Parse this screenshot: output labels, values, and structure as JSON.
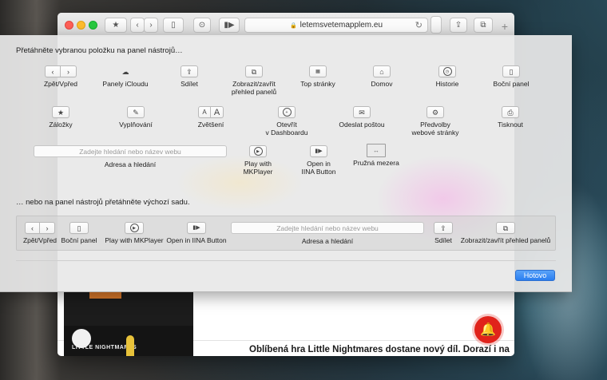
{
  "browser": {
    "url": "letemsvetemapplem.eu",
    "lock_icon": "🔒"
  },
  "page": {
    "headline": "Oblíbená hra Little Nightmares dostane nový díl. Dorazí i na",
    "thumb_label": "LITTLE NIGHTMARES"
  },
  "sheet": {
    "title": "Přetáhněte vybranou položku na panel nástrojů…",
    "items_row1": [
      {
        "label": "Zpět/Vpřed",
        "icon": "back-forward-icon"
      },
      {
        "label": "Panely iCloudu",
        "icon": "cloud-icon"
      },
      {
        "label": "Sdílet",
        "icon": "share-icon"
      },
      {
        "label": "Zobrazit/zavřít\npřehled panelů",
        "icon": "tab-overview-icon"
      },
      {
        "label": "Top stránky",
        "icon": "grid-icon"
      },
      {
        "label": "Domov",
        "icon": "home-icon"
      },
      {
        "label": "Historie",
        "icon": "clock-icon"
      },
      {
        "label": "Boční panel",
        "icon": "sidebar-icon"
      }
    ],
    "items_row2": [
      {
        "label": "Záložky",
        "icon": "bookmarks-icon"
      },
      {
        "label": "Vyplňování",
        "icon": "autofill-icon"
      },
      {
        "label": "Zvětšení",
        "icon": "zoom-icon"
      },
      {
        "label": "Otevřít\nv Dashboardu",
        "icon": "dashboard-icon"
      },
      {
        "label": "Odeslat poštou",
        "icon": "mail-icon"
      },
      {
        "label": "Předvolby\nwebové stránky",
        "icon": "gear-icon"
      },
      {
        "label": "Tisknout",
        "icon": "print-icon"
      }
    ],
    "items_row3": [
      {
        "label": "Adresa a hledání",
        "placeholder": "Zadejte hledání nebo název webu"
      },
      {
        "label": "Play with\nMKPlayer",
        "icon": "play-icon"
      },
      {
        "label": "Open in\nIINA Button",
        "icon": "iina-icon"
      },
      {
        "label": "Pružná mezera",
        "icon": "flexible-space-icon"
      }
    ],
    "default_title": "… nebo na panel nástrojů přetáhněte výchozí sadu.",
    "default_set": [
      {
        "label": "Zpět/Vpřed"
      },
      {
        "label": "Boční panel"
      },
      {
        "label": "Play with MKPlayer"
      },
      {
        "label": "Open in IINA Button"
      },
      {
        "label": "Adresa a hledání",
        "placeholder": "Zadejte hledání nebo název webu"
      },
      {
        "label": "Sdílet"
      },
      {
        "label": "Zobrazit/zavřít přehled panelů"
      }
    ],
    "done_label": "Hotovo",
    "zoom_small": "A",
    "zoom_large": "A"
  },
  "colors": {
    "accent": "#2a7ef0",
    "notification": "#e0231b"
  }
}
